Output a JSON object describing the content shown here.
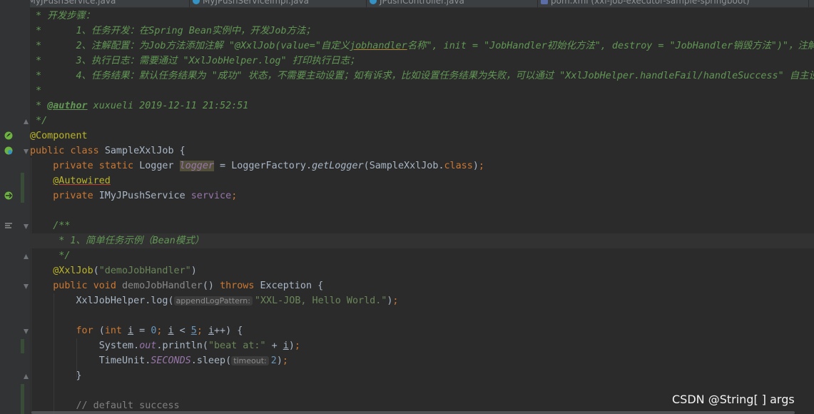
{
  "tabs": [
    {
      "label": "IMyJPushService.java"
    },
    {
      "label": "MyJPushServiceImpl.java"
    },
    {
      "label": "JPushController.java"
    },
    {
      "label": "pom.xml (xxl-job-executor-sample-springboot)"
    }
  ],
  "code": {
    "l1": "开发步骤：",
    "l2a": "1、任务开发：在Spring Bean实例中，开发Job方法；",
    "l3a": "2、注解配置：为Job方法添加注解 \"@XxlJob(value=\"自定义",
    "l3b": "jobhandler",
    "l3c": "名称\", init = \"JobHandler初始化方法\", destroy = \"JobHandler销毁方法\")\"，注解va",
    "l4a": "3、执行日志：需要通过 \"XxlJobHelper.log\" 打印执行日志；",
    "l5a": "4、任务结果：默认任务结果为 \"成功\" 状态，不需要主动设置；如有诉求，比如设置任务结果为失败，可以通过 \"XxlJobHelper.handleFail/handleSuccess\" 自主设置",
    "author_tag": "@author",
    "author_text": " xuxueli 2019-12-11 21:52:51",
    "ann_component": "@Component",
    "kw_public": "public",
    "kw_class": "class",
    "class_name": "SampleXxlJob",
    "kw_private": "private",
    "kw_static": "static",
    "type_logger": "Logger",
    "fld_logger": "logger",
    "logger_factory": "LoggerFactory",
    "get_logger": "getLogger",
    "logger_arg": "SampleXxlJob",
    "kw_class_lit": "class",
    "ann_autowired": "@Autowired",
    "type_service": "IMyJPushService",
    "fld_service": "service",
    "doc_open": "/**",
    "doc_line": " * 1、简单任务示例（Bean模式）",
    "doc_close": " */",
    "ann_xxljob": "@XxlJob",
    "str_handler": "\"demoJobHandler\"",
    "kw_void": "void",
    "method_name": "demoJobHandler",
    "kw_throws": "throws",
    "type_exception": "Exception",
    "helper": "XxlJobHelper",
    "log": "log",
    "hint_pattern": "appendLogPattern:",
    "str_hello": "\"XXL-JOB, Hello World.\"",
    "kw_for": "for",
    "kw_int": "int",
    "var_i": "i",
    "num_0": "0",
    "num_5": "5",
    "system": "System",
    "out": "out",
    "println": "println",
    "str_beat": "\"beat at:\"",
    "timeunit": "TimeUnit",
    "seconds": "SECONDS",
    "sleep": "sleep",
    "hint_timeout": "timeout:",
    "num_2": "2",
    "comment_success": "// default success"
  },
  "watermark": "CSDN @String[ ] args",
  "colors": {
    "background": "#2b2b2b",
    "gutter": "#313335",
    "comment": "#629755",
    "keyword": "#cc7832",
    "annotation": "#bbb529",
    "string": "#6a8759",
    "number": "#6897bb",
    "field": "#9876aa",
    "method": "#ffc66d",
    "text": "#a9b7c6"
  }
}
